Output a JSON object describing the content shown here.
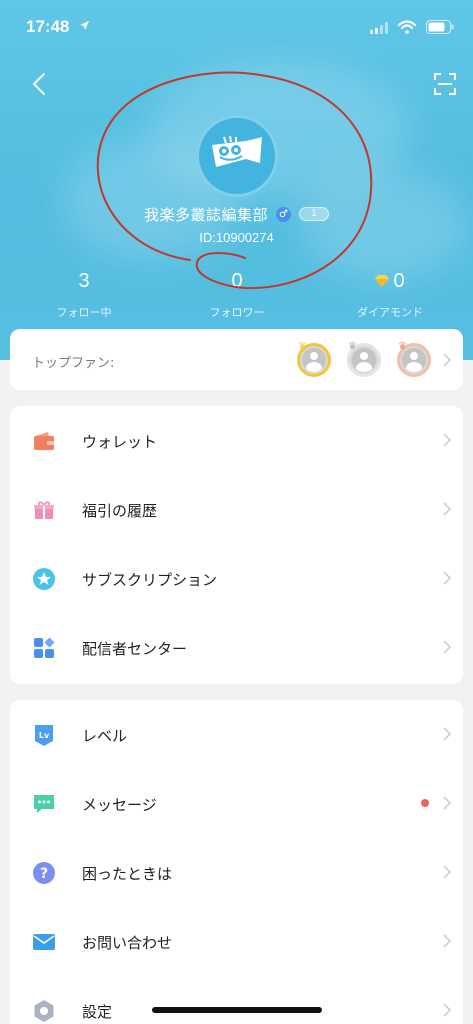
{
  "status_bar": {
    "time": "17:48"
  },
  "profile": {
    "username": "我楽多叢誌編集部",
    "gender_symbol": "♂",
    "level": "1",
    "user_id": "ID:10900274"
  },
  "stats": [
    {
      "value": "3",
      "label": "フォロー中"
    },
    {
      "value": "0",
      "label": "フォロワー"
    },
    {
      "value": "0",
      "label": "ダイアモンド"
    }
  ],
  "top_fans": {
    "label": "トップファン:"
  },
  "menu_group_1": [
    {
      "label": "ウォレット",
      "icon": "wallet-icon"
    },
    {
      "label": "福引の履歴",
      "icon": "gift-icon"
    },
    {
      "label": "サブスクリプション",
      "icon": "star-badge-icon"
    },
    {
      "label": "配信者センター",
      "icon": "grid-icon"
    }
  ],
  "menu_group_2": [
    {
      "label": "レベル",
      "icon": "level-icon"
    },
    {
      "label": "メッセージ",
      "icon": "chat-icon"
    },
    {
      "label": "困ったときは",
      "icon": "question-icon"
    },
    {
      "label": "お問い合わせ",
      "icon": "mail-icon"
    },
    {
      "label": "設定",
      "icon": "settings-icon"
    }
  ],
  "colors": {
    "header": "#56bfe2",
    "accent_red": "#e8655a",
    "annotation": "#c0392b"
  }
}
